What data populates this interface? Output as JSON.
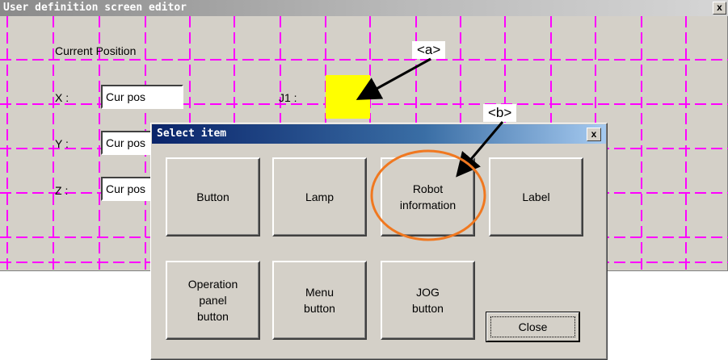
{
  "editor": {
    "title": "User definition screen editor",
    "close_glyph": "x",
    "current_position_label": "Current Position",
    "x_label": "X :",
    "y_label": "Y :",
    "z_label": "Z :",
    "j1_label": "J1 :",
    "x_value": "Cur pos",
    "y_value": "Cur pos",
    "z_value": "Cur pos",
    "lamp_color": "#ffff00",
    "grid_color": "#ff00ff"
  },
  "dialog": {
    "title": "Select item",
    "close_glyph": "x",
    "buttons": [
      "Button",
      "Lamp",
      "Robot\ninformation",
      "Label",
      "Operation\npanel\nbutton",
      "Menu\nbutton",
      "JOG\nbutton"
    ],
    "close_label": "Close"
  },
  "annotations": {
    "a_label": "<a>",
    "b_label": "<b>",
    "highlight_color": "#f07820"
  }
}
